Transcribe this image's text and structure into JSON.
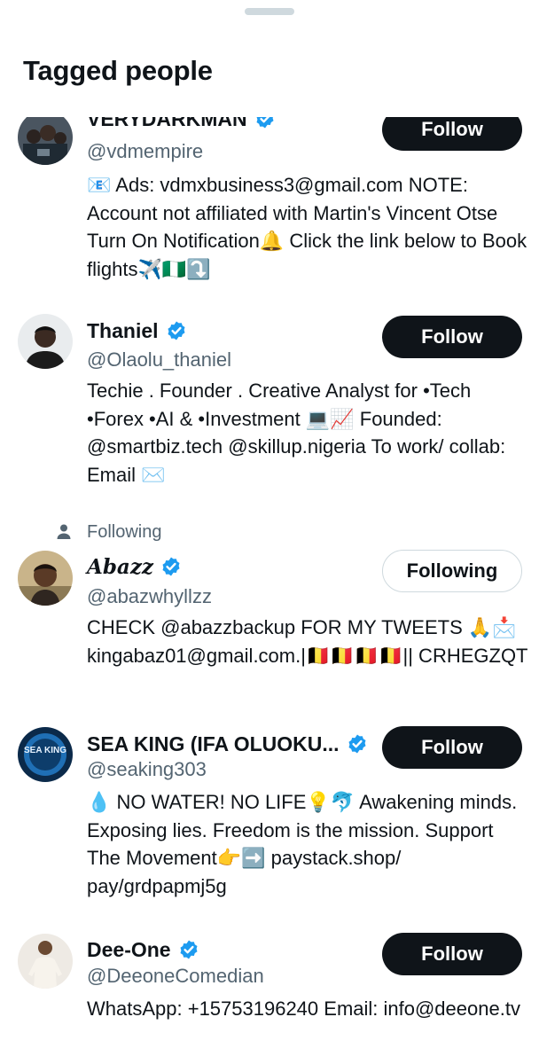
{
  "sheet": {
    "title": "Tagged people"
  },
  "colors": {
    "follow_bg": "#0f1419",
    "verified_blue": "#1d9bf0",
    "secondary_text": "#536471"
  },
  "users": [
    {
      "name": "VERYDARKMAN",
      "handle": "@vdmempire",
      "verified": true,
      "button": "Follow",
      "bio": "📧 Ads: vdmxbusiness3@gmail.com  NOTE: Account not affiliated with Martin's Vincent Otse  Turn On Notification🔔  Click the link below to Book flights✈️🇳🇬⤵️"
    },
    {
      "name": "Thaniel",
      "handle": "@Olaolu_thaniel",
      "verified": true,
      "button": "Follow",
      "bio": "Techie . Founder . Creative Analyst for •Tech •Forex •AI & •Investment 💻📈 Founded: @smartbiz.tech @skillup.nigeria To work/ collab: Email ✉️"
    },
    {
      "social_context": "Following",
      "name": "Abazz",
      "handle": "@abazwhyllzz",
      "verified": true,
      "button": "Following",
      "bio": "CHECK @abazzbackup FOR MY TWEETS 🙏📩kingabaz01@gmail.com.|🇧🇪🇧🇪🇧🇪🇧🇪|| CRHEGZQT"
    },
    {
      "name": "SEA KING (IFA OLUOKU...",
      "handle": "@seaking303",
      "verified": true,
      "button": "Follow",
      "avatar_text": "SEA KING",
      "bio": "💧 NO WATER! NO LIFE💡🐬 Awakening minds. Exposing lies. Freedom is the mission. Support The Movement👉➡️ paystack.shop/ pay/grdpapmj5g"
    },
    {
      "name": "Dee-One",
      "handle": "@DeeoneComedian",
      "verified": true,
      "button": "Follow",
      "bio": "WhatsApp: +15753196240 Email: info@deeone.tv"
    }
  ]
}
